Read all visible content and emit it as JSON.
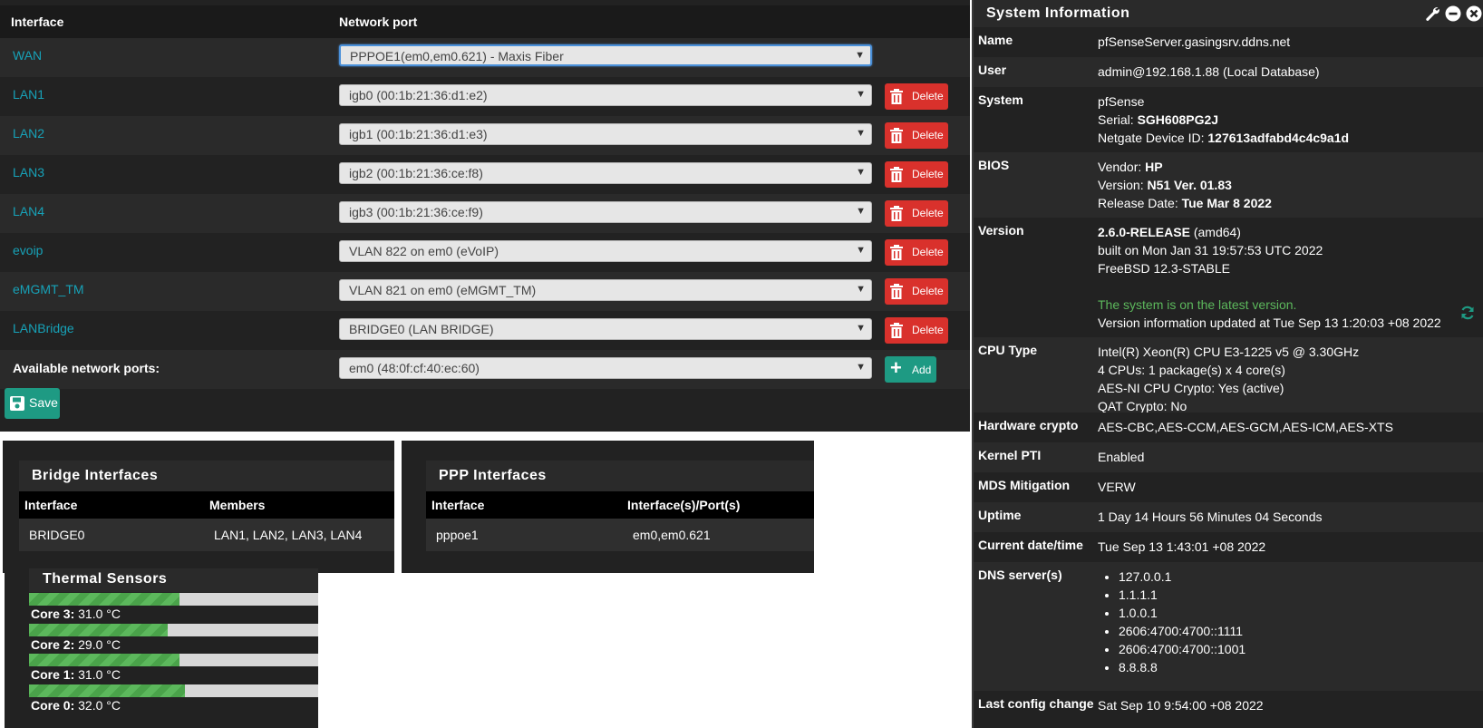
{
  "assignments": {
    "col_interface": "Interface",
    "col_network_port": "Network port",
    "rows": [
      {
        "name": "WAN",
        "port": "PPPOE1(em0,em0.621) - Maxis Fiber",
        "deletable": false
      },
      {
        "name": "LAN1",
        "port": "igb0 (00:1b:21:36:d1:e2)",
        "deletable": true
      },
      {
        "name": "LAN2",
        "port": "igb1 (00:1b:21:36:d1:e3)",
        "deletable": true
      },
      {
        "name": "LAN3",
        "port": "igb2 (00:1b:21:36:ce:f8)",
        "deletable": true
      },
      {
        "name": "LAN4",
        "port": "igb3 (00:1b:21:36:ce:f9)",
        "deletable": true
      },
      {
        "name": "evoip",
        "port": "VLAN 822 on em0 (eVoIP)",
        "deletable": true
      },
      {
        "name": "eMGMT_TM",
        "port": "VLAN 821 on em0 (eMGMT_TM)",
        "deletable": true
      },
      {
        "name": "LANBridge",
        "port": "BRIDGE0 (LAN BRIDGE)",
        "deletable": true
      }
    ],
    "delete_label": "Delete",
    "available_label": "Available network ports:",
    "available_port": "em0 (48:0f:cf:40:ec:60)",
    "add_label": "Add",
    "save_label": "Save"
  },
  "bridge": {
    "title": "Bridge Interfaces",
    "col_interface": "Interface",
    "col_members": "Members",
    "row": {
      "interface": "BRIDGE0",
      "members": "LAN1, LAN2, LAN3, LAN4"
    }
  },
  "ppp": {
    "title": "PPP Interfaces",
    "col_interface": "Interface",
    "col_ports": "Interface(s)/Port(s)",
    "row": {
      "interface": "pppoe1",
      "ports": "em0,em0.621"
    }
  },
  "thermal": {
    "title": "Thermal Sensors",
    "sensors": [
      {
        "label": "Core 3:",
        "value": "31.0 °C",
        "fill_fraction": 0.52
      },
      {
        "label": "Core 2:",
        "value": "29.0 °C",
        "fill_fraction": 0.48
      },
      {
        "label": "Core 1:",
        "value": "31.0 °C",
        "fill_fraction": 0.52
      },
      {
        "label": "Core 0:",
        "value": "32.0 °C",
        "fill_fraction": 0.54
      }
    ]
  },
  "sysinfo": {
    "title": "System Information",
    "name_k": "Name",
    "name_v": "pfSenseServer.gasingsrv.ddns.net",
    "user_k": "User",
    "user_v": "admin@192.168.1.88 (Local Database)",
    "system_k": "System",
    "system_v1": "pfSense",
    "serial_k": "Serial: ",
    "serial_v": "SGH608PG2J",
    "netgate_k": "Netgate Device ID: ",
    "netgate_v": "127613adfabd4c4c9a1d",
    "bios_k": "BIOS",
    "vendor_k": "Vendor: ",
    "vendor_v": "HP",
    "biosver_k": "Version: ",
    "biosver_v": "N51 Ver. 01.83",
    "release_k": "Release Date: ",
    "release_v": "Tue Mar 8 2022",
    "version_k": "Version",
    "version_b": "2.6.0-RELEASE",
    "version_arch": " (amd64)",
    "built": "built on Mon Jan 31 19:57:53 UTC 2022",
    "freebsd": "FreeBSD 12.3-STABLE",
    "latest": "The system is on the latest version.",
    "updated": "Version information updated at Tue Sep 13 1:20:03 +08 2022",
    "cpu_k": "CPU Type",
    "cpu_1": "Intel(R) Xeon(R) CPU E3-1225 v5 @ 3.30GHz",
    "cpu_2": "4 CPUs: 1 package(s) x 4 core(s)",
    "cpu_3": "AES-NI CPU Crypto: Yes (active)",
    "cpu_4": "QAT Crypto: No",
    "hwc_k": "Hardware crypto",
    "hwc_v": "AES-CBC,AES-CCM,AES-GCM,AES-ICM,AES-XTS",
    "pti_k": "Kernel PTI",
    "pti_v": "Enabled",
    "mds_k": "MDS Mitigation",
    "mds_v": "VERW",
    "uptime_k": "Uptime",
    "uptime_v": "1 Day 14 Hours 56 Minutes 04 Seconds",
    "date_k": "Current date/time",
    "date_v": "Tue Sep 13 1:43:01 +08 2022",
    "dns_k": "DNS server(s)",
    "dns": [
      "127.0.0.1",
      "1.1.1.1",
      "1.0.0.1",
      "2606:4700:4700::1111",
      "2606:4700:4700::1001",
      "8.8.8.8"
    ],
    "config_k": "Last config change",
    "config_v": "Sat Sep 10 9:54:00 +08 2022"
  },
  "colors": {
    "accent_teal": "#17a2b8",
    "delete_red": "#d9312c",
    "add_green": "#1e9a83",
    "ok_green": "#5cb85c"
  }
}
